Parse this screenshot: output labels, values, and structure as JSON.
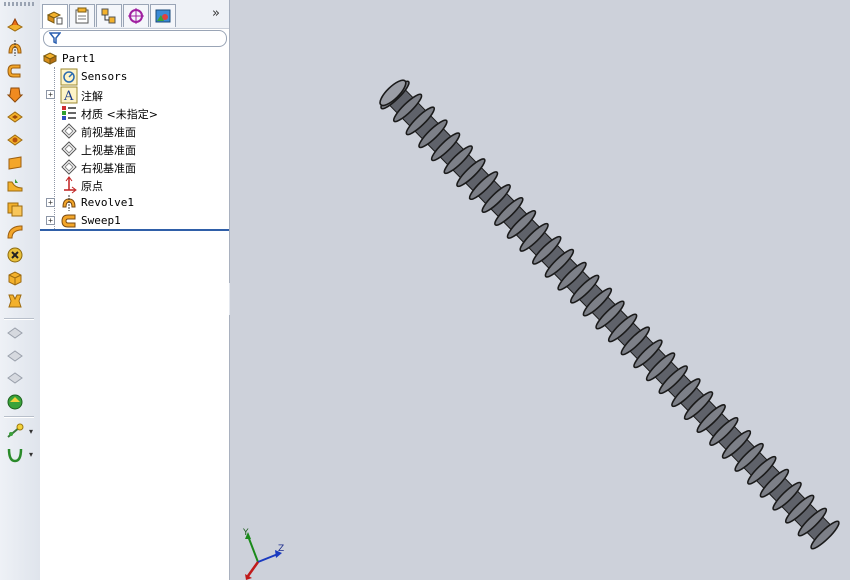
{
  "feature_manager": {
    "tabs": [
      {
        "name": "featuremanager-tab",
        "icon": "feature-tree-icon",
        "active": true
      },
      {
        "name": "propertymanager-tab",
        "icon": "property-manager-icon",
        "active": false
      },
      {
        "name": "configurationmanager-tab",
        "icon": "configuration-manager-icon",
        "active": false
      },
      {
        "name": "dimxpert-tab",
        "icon": "dimxpert-icon",
        "active": false
      },
      {
        "name": "display-manager-tab",
        "icon": "display-manager-icon",
        "active": false
      }
    ],
    "more_label": "»",
    "filter_icon": "filter-icon",
    "tree": [
      {
        "label": "Part1",
        "icon": "part-icon",
        "expandable": false
      },
      {
        "label": "Sensors",
        "icon": "sensors-icon",
        "expandable": false
      },
      {
        "label": "注解",
        "icon": "annotations-icon",
        "expandable": true
      },
      {
        "label": "材质 <未指定>",
        "icon": "material-icon",
        "expandable": false
      },
      {
        "label": "前视基准面",
        "icon": "plane-icon",
        "expandable": false
      },
      {
        "label": "上视基准面",
        "icon": "plane-icon",
        "expandable": false
      },
      {
        "label": "右视基准面",
        "icon": "plane-icon",
        "expandable": false
      },
      {
        "label": "原点",
        "icon": "origin-icon",
        "expandable": false
      },
      {
        "label": "Revolve1",
        "icon": "revolve-icon",
        "expandable": true
      },
      {
        "label": "Sweep1",
        "icon": "sweep-icon",
        "expandable": true
      }
    ]
  },
  "features_toolbar": {
    "items": [
      "extruded-boss-icon",
      "revolved-boss-icon",
      "swept-boss-icon",
      "lofted-boss-icon",
      "extruded-cut-icon",
      "revolved-cut-icon",
      "plane-face-icon",
      "fillet-icon",
      "shell-icon",
      "sweep-cut-icon",
      "hole-wizard-icon",
      "boundary-icon",
      "rib-icon",
      "draft-icon",
      "dome-icon",
      "wrap-icon",
      "intersect-icon",
      "reference-geometry-icon",
      "curves-icon"
    ]
  },
  "viewport": {
    "model": "threaded-rod",
    "triad_axes": [
      "Y",
      "Z"
    ],
    "colors": {
      "background": "#cdd1da",
      "model_fill": "#7d8088",
      "model_edge": "#1a1a1a"
    }
  }
}
